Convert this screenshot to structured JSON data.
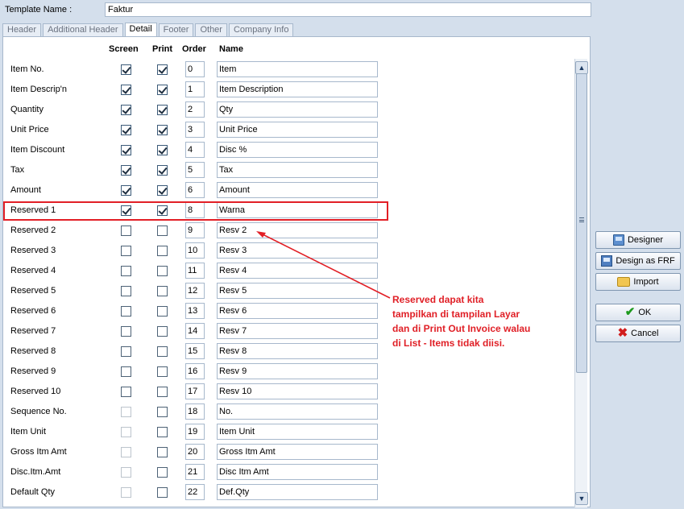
{
  "template_name": {
    "label": "Template Name :",
    "value": "Faktur"
  },
  "tabs": [
    "Header",
    "Additional Header",
    "Detail",
    "Footer",
    "Other",
    "Company Info"
  ],
  "active_tab": "Detail",
  "columns": {
    "screen": "Screen",
    "print": "Print",
    "order": "Order",
    "name": "Name"
  },
  "rows": [
    {
      "label": "Item No.",
      "screen": "on",
      "print": "on",
      "order": "0",
      "name": "Item"
    },
    {
      "label": "Item Descrip'n",
      "screen": "on",
      "print": "on",
      "order": "1",
      "name": "Item Description"
    },
    {
      "label": "Quantity",
      "screen": "on",
      "print": "on",
      "order": "2",
      "name": "Qty"
    },
    {
      "label": "Unit Price",
      "screen": "on",
      "print": "on",
      "order": "3",
      "name": "Unit Price"
    },
    {
      "label": "Item Discount",
      "screen": "on",
      "print": "on",
      "order": "4",
      "name": "Disc %"
    },
    {
      "label": "Tax",
      "screen": "on",
      "print": "on",
      "order": "5",
      "name": "Tax"
    },
    {
      "label": "Amount",
      "screen": "on",
      "print": "on",
      "order": "6",
      "name": "Amount"
    },
    {
      "label": "Reserved 1",
      "screen": "on",
      "print": "on",
      "order": "8",
      "name": "Warna"
    },
    {
      "label": "Reserved 2",
      "screen": "off",
      "print": "off",
      "order": "9",
      "name": "Resv 2"
    },
    {
      "label": "Reserved 3",
      "screen": "off",
      "print": "off",
      "order": "10",
      "name": "Resv 3"
    },
    {
      "label": "Reserved 4",
      "screen": "off",
      "print": "off",
      "order": "11",
      "name": "Resv 4"
    },
    {
      "label": "Reserved 5",
      "screen": "off",
      "print": "off",
      "order": "12",
      "name": "Resv 5"
    },
    {
      "label": "Reserved 6",
      "screen": "off",
      "print": "off",
      "order": "13",
      "name": "Resv 6"
    },
    {
      "label": "Reserved 7",
      "screen": "off",
      "print": "off",
      "order": "14",
      "name": "Resv 7"
    },
    {
      "label": "Reserved 8",
      "screen": "off",
      "print": "off",
      "order": "15",
      "name": "Resv 8"
    },
    {
      "label": "Reserved 9",
      "screen": "off",
      "print": "off",
      "order": "16",
      "name": "Resv 9"
    },
    {
      "label": "Reserved 10",
      "screen": "off",
      "print": "off",
      "order": "17",
      "name": "Resv 10"
    },
    {
      "label": "Sequence No.",
      "screen": "dis",
      "print": "off",
      "order": "18",
      "name": "No."
    },
    {
      "label": "Item Unit",
      "screen": "dis",
      "print": "off",
      "order": "19",
      "name": "Item Unit"
    },
    {
      "label": "Gross Itm Amt",
      "screen": "dis",
      "print": "off",
      "order": "20",
      "name": "Gross Itm Amt"
    },
    {
      "label": "Disc.Itm.Amt",
      "screen": "dis",
      "print": "off",
      "order": "21",
      "name": "Disc Itm Amt"
    },
    {
      "label": "Default Qty",
      "screen": "dis",
      "print": "off",
      "order": "22",
      "name": "Def.Qty"
    }
  ],
  "buttons": {
    "designer": "Designer",
    "design_frf": "Design as FRF",
    "import": "Import",
    "ok": "OK",
    "cancel": "Cancel"
  },
  "annotation": {
    "lines": [
      "Reserved dapat kita",
      "tampilkan di tampilan Layar",
      "dan di Print Out Invoice walau",
      "di List - Items tidak diisi."
    ],
    "color": "#e01f26"
  },
  "icons": {
    "designer": "designer-icon",
    "design_frf": "frf-designer-icon",
    "import": "folder-open-icon",
    "ok": "check-icon",
    "cancel": "cross-icon"
  }
}
